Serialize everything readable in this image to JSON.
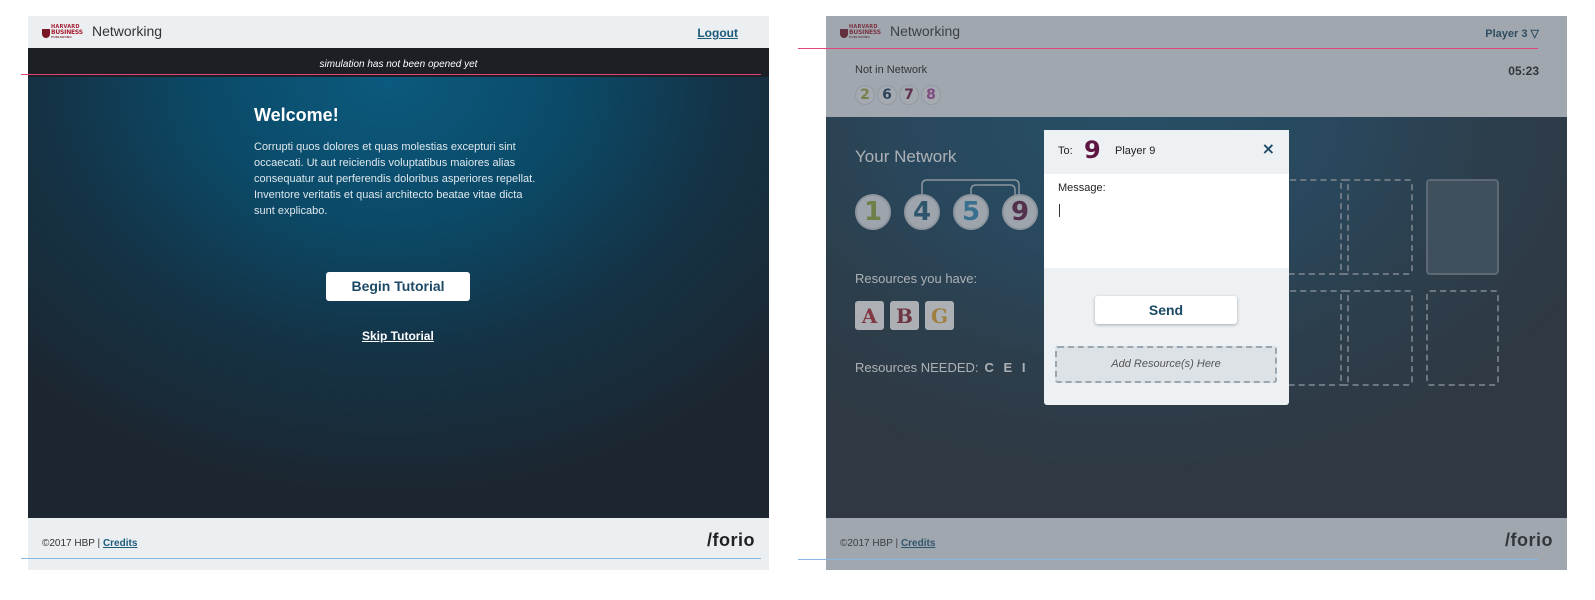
{
  "left": {
    "header": {
      "logo": [
        "HARVARD",
        "BUSINESS",
        "PUBLISHING"
      ],
      "app_title": "Networking",
      "logout": "Logout"
    },
    "banner": "simulation has not been opened yet",
    "main": {
      "welcome": "Welcome!",
      "intro": "Corrupti quos dolores et quas molestias excepturi sint occaecati. Ut aut reiciendis voluptatibus maiores alias consequatur aut perferendis doloribus asperiores repellat. Inventore veritatis et quasi architecto beatae vitae dicta sunt explicabo.",
      "begin_button": "Begin Tutorial",
      "skip_link": "Skip Tutorial"
    },
    "footer": {
      "copyright": "©2017 HBP |",
      "credits": "Credits",
      "brand": "/forio"
    }
  },
  "right": {
    "header": {
      "logo": [
        "HARVARD",
        "BUSINESS",
        "PUBLISHING"
      ],
      "app_title": "Networking",
      "player_menu": "Player 3 ▽"
    },
    "not_in_network": {
      "label": "Not in Network",
      "timer": "05:23",
      "players": [
        {
          "num": "2",
          "color": "#a0a83c"
        },
        {
          "num": "6",
          "color": "#1c3a56"
        },
        {
          "num": "7",
          "color": "#6e1a4a"
        },
        {
          "num": "8",
          "color": "#b0489e"
        }
      ]
    },
    "your_network": {
      "title": "Your Network",
      "members": [
        {
          "num": "1",
          "color": "#8aa83a"
        },
        {
          "num": "4",
          "color": "#1c5a7a"
        },
        {
          "num": "5",
          "color": "#2e8ab8"
        },
        {
          "num": "9",
          "color": "#5e1742"
        }
      ]
    },
    "resources": {
      "have_label": "Resources you have:",
      "have": [
        {
          "letter": "A",
          "color": "#b3242e"
        },
        {
          "letter": "B",
          "color": "#8e2030"
        },
        {
          "letter": "G",
          "color": "#e8a82a"
        }
      ],
      "needed_label": "Resources NEEDED:",
      "needed_letters": "C E I"
    },
    "modal": {
      "to_label": "To:",
      "to_number": "9",
      "to_name": "Player 9",
      "close": "×",
      "message_label": "Message:",
      "send_button": "Send",
      "add_resource": "Add Resource(s) Here"
    },
    "footer": {
      "copyright": "©2017 HBP |",
      "credits": "Credits",
      "brand": "/forio"
    }
  }
}
